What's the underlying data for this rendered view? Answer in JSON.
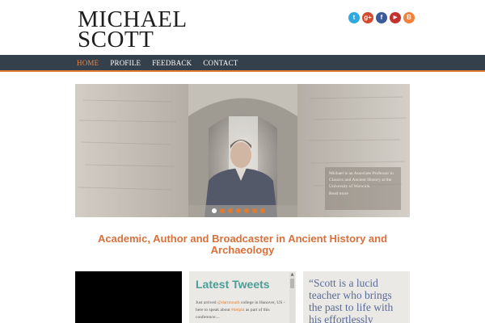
{
  "site": {
    "logo_line1": "MICHAEL",
    "logo_line2": "SCOTT"
  },
  "socials": [
    {
      "name": "twitter-icon",
      "glyph": "t",
      "color": "#2fa9e0"
    },
    {
      "name": "google-plus-icon",
      "glyph": "g+",
      "color": "#d3492e"
    },
    {
      "name": "facebook-icon",
      "glyph": "f",
      "color": "#3a5a9b"
    },
    {
      "name": "youtube-icon",
      "glyph": "▶",
      "color": "#c4302b"
    },
    {
      "name": "blogger-icon",
      "glyph": "B",
      "color": "#f0803a"
    }
  ],
  "nav": {
    "items": [
      "HOME",
      "PROFILE",
      "FEEDBACK",
      "CONTACT"
    ],
    "active_index": 0
  },
  "hero": {
    "caption": "Michael is an Associate Professor in Classics and Ancient History at the University of Warwick.",
    "read_more": "Read more",
    "slide_count": 7,
    "active_slide": 0
  },
  "tagline": "Academic, Author and Broadcaster in Ancient History and Archaeology",
  "tweets": {
    "title": "Latest Tweets",
    "text_1": "Just arrived ",
    "mention": "@dartmouth",
    "text_2": " college in Hanover, US - here to speak about ",
    "hashtag": "#delphi",
    "text_3": " as part of this conference:..."
  },
  "quote": {
    "text": "“Scott is a lucid teacher who brings the past to life with his effortlessly engaging style.”"
  },
  "colors": {
    "accent": "#e07b30",
    "nav_bg": "#34414c",
    "tweets_title": "#4e9e98",
    "quote_text": "#5a6a98"
  }
}
